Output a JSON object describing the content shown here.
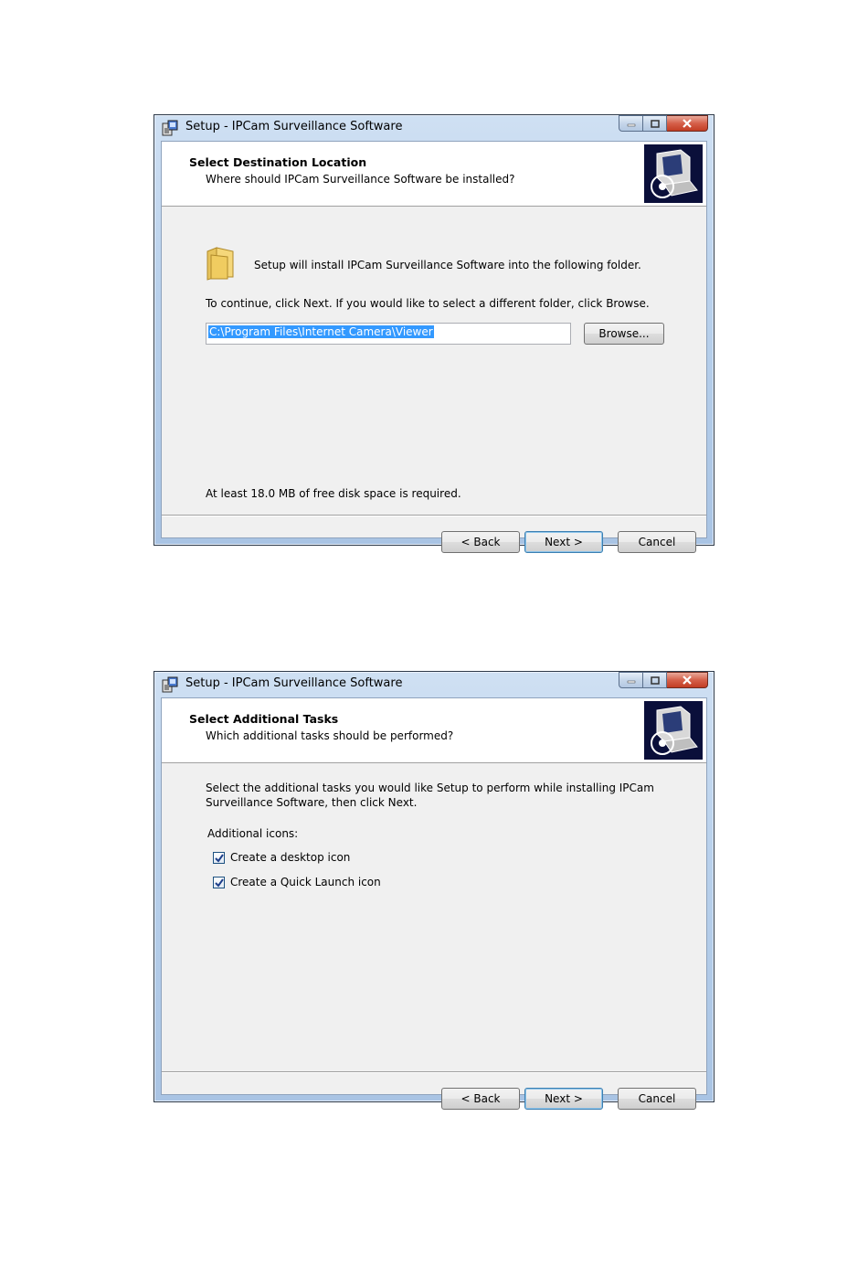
{
  "window1": {
    "title": "Setup - IPCam Surveillance Software",
    "header_title": "Select Destination Location",
    "header_subtitle": "Where should IPCam Surveillance Software be installed?",
    "install_text": "Setup will install IPCam Surveillance Software into the following folder.",
    "continue_text": "To continue, click Next. If you would like to select a different folder, click Browse.",
    "path_value": "C:\\Program Files\\Internet Camera\\Viewer",
    "browse_label": "Browse...",
    "disk_space_text": "At least 18.0 MB of free disk space is required.",
    "back_label": "< Back",
    "next_label": "Next >",
    "cancel_label": "Cancel"
  },
  "window2": {
    "title": "Setup - IPCam Surveillance Software",
    "header_title": "Select Additional Tasks",
    "header_subtitle": "Which additional tasks should be performed?",
    "intro_line1": "Select the additional tasks you would like Setup to perform while installing IPCam",
    "intro_line2": "Surveillance Software, then click Next.",
    "icons_heading": "Additional icons:",
    "tasks": [
      {
        "label": "Create a desktop icon",
        "checked": true
      },
      {
        "label": "Create a Quick Launch icon",
        "checked": true
      }
    ],
    "back_label": "< Back",
    "next_label": "Next >",
    "cancel_label": "Cancel"
  },
  "icons": {
    "app": "installer-icon",
    "folder": "folder-icon",
    "header": "computer-disc-icon",
    "minimize": "minimize-icon",
    "maximize": "maximize-icon",
    "close": "close-icon"
  },
  "colors": {
    "title_bar": "#b9d1ec",
    "close_button": "#d5604a",
    "selection": "#3399ff",
    "dialog_body": "#f0f0f0"
  }
}
